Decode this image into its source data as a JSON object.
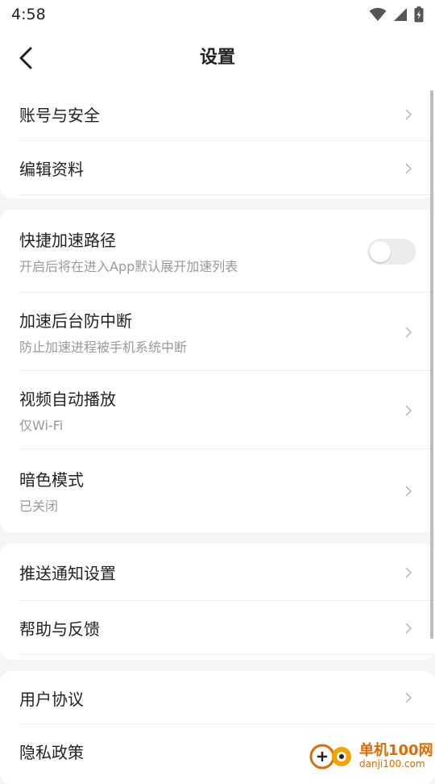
{
  "status_bar": {
    "time": "4:58"
  },
  "header": {
    "title": "设置"
  },
  "groups": [
    {
      "items": [
        {
          "title": "账号与安全"
        },
        {
          "title": "编辑资料"
        }
      ]
    },
    {
      "items": [
        {
          "title": "快捷加速路径",
          "subtitle": "开启后将在进入App默认展开加速列表",
          "toggle": false
        },
        {
          "title": "加速后台防中断",
          "subtitle": "防止加速进程被手机系统中断"
        },
        {
          "title": "视频自动播放",
          "subtitle": "仅Wi-Fi"
        },
        {
          "title": "暗色模式",
          "subtitle": "已关闭"
        }
      ]
    },
    {
      "items": [
        {
          "title": "推送通知设置"
        },
        {
          "title": "帮助与反馈"
        }
      ]
    },
    {
      "items": [
        {
          "title": "用户协议"
        },
        {
          "title": "隐私政策"
        }
      ]
    }
  ],
  "watermark": {
    "name": "单机100网",
    "url": "danji100.com"
  },
  "colors": {
    "accent": "#e26a00",
    "toggle_off": "#ececec",
    "subtitle": "#999999"
  }
}
